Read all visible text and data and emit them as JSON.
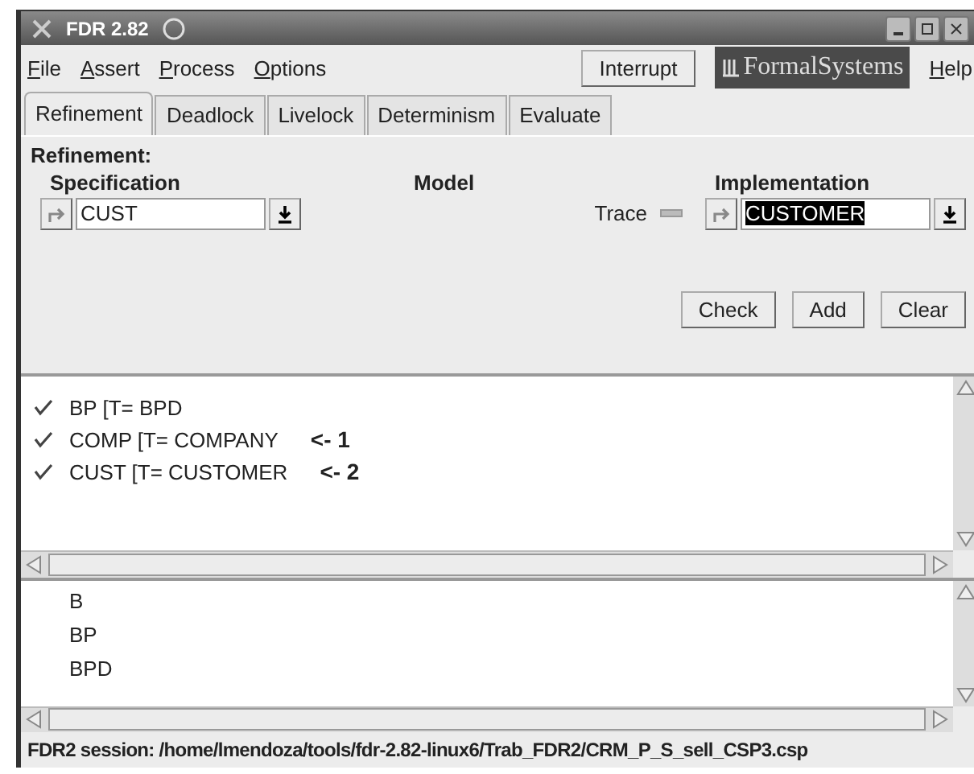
{
  "window": {
    "title": "FDR 2.82"
  },
  "menu": [
    {
      "label": "File"
    },
    {
      "label": "Assert"
    },
    {
      "label": "Process"
    },
    {
      "label": "Options"
    }
  ],
  "interrupt_button": "Interrupt",
  "logo": "FormalSystems",
  "help": "Help",
  "tabs": [
    {
      "label": "Refinement",
      "selected": true
    },
    {
      "label": "Deadlock",
      "selected": false
    },
    {
      "label": "Livelock",
      "selected": false
    },
    {
      "label": "Determinism",
      "selected": false
    },
    {
      "label": "Evaluate",
      "selected": false
    }
  ],
  "panel": {
    "heading": "Refinement:",
    "specification": {
      "label": "Specification",
      "value": "CUST",
      "selected": false
    },
    "model": {
      "label": "Model",
      "value": "Trace"
    },
    "implementation": {
      "label": "Implementation",
      "value": "CUSTOMER",
      "selected": true
    }
  },
  "buttons": [
    "Check",
    "Add",
    "Clear"
  ],
  "assertions": [
    {
      "text": "BP [T= BPD",
      "passed": true
    },
    {
      "text": "COMP [T= COMPANY",
      "passed": true,
      "note": "<- 1"
    },
    {
      "text": "CUST [T= CUSTOMER",
      "passed": true,
      "note": "<- 2"
    }
  ],
  "processes": [
    "B",
    "BP",
    "BPD"
  ],
  "status_bar": "FDR2 session: /home/lmendoza/tools/fdr-2.82-linux6/Trab_FDR2/CRM_P_S_sell_CSP3.csp"
}
